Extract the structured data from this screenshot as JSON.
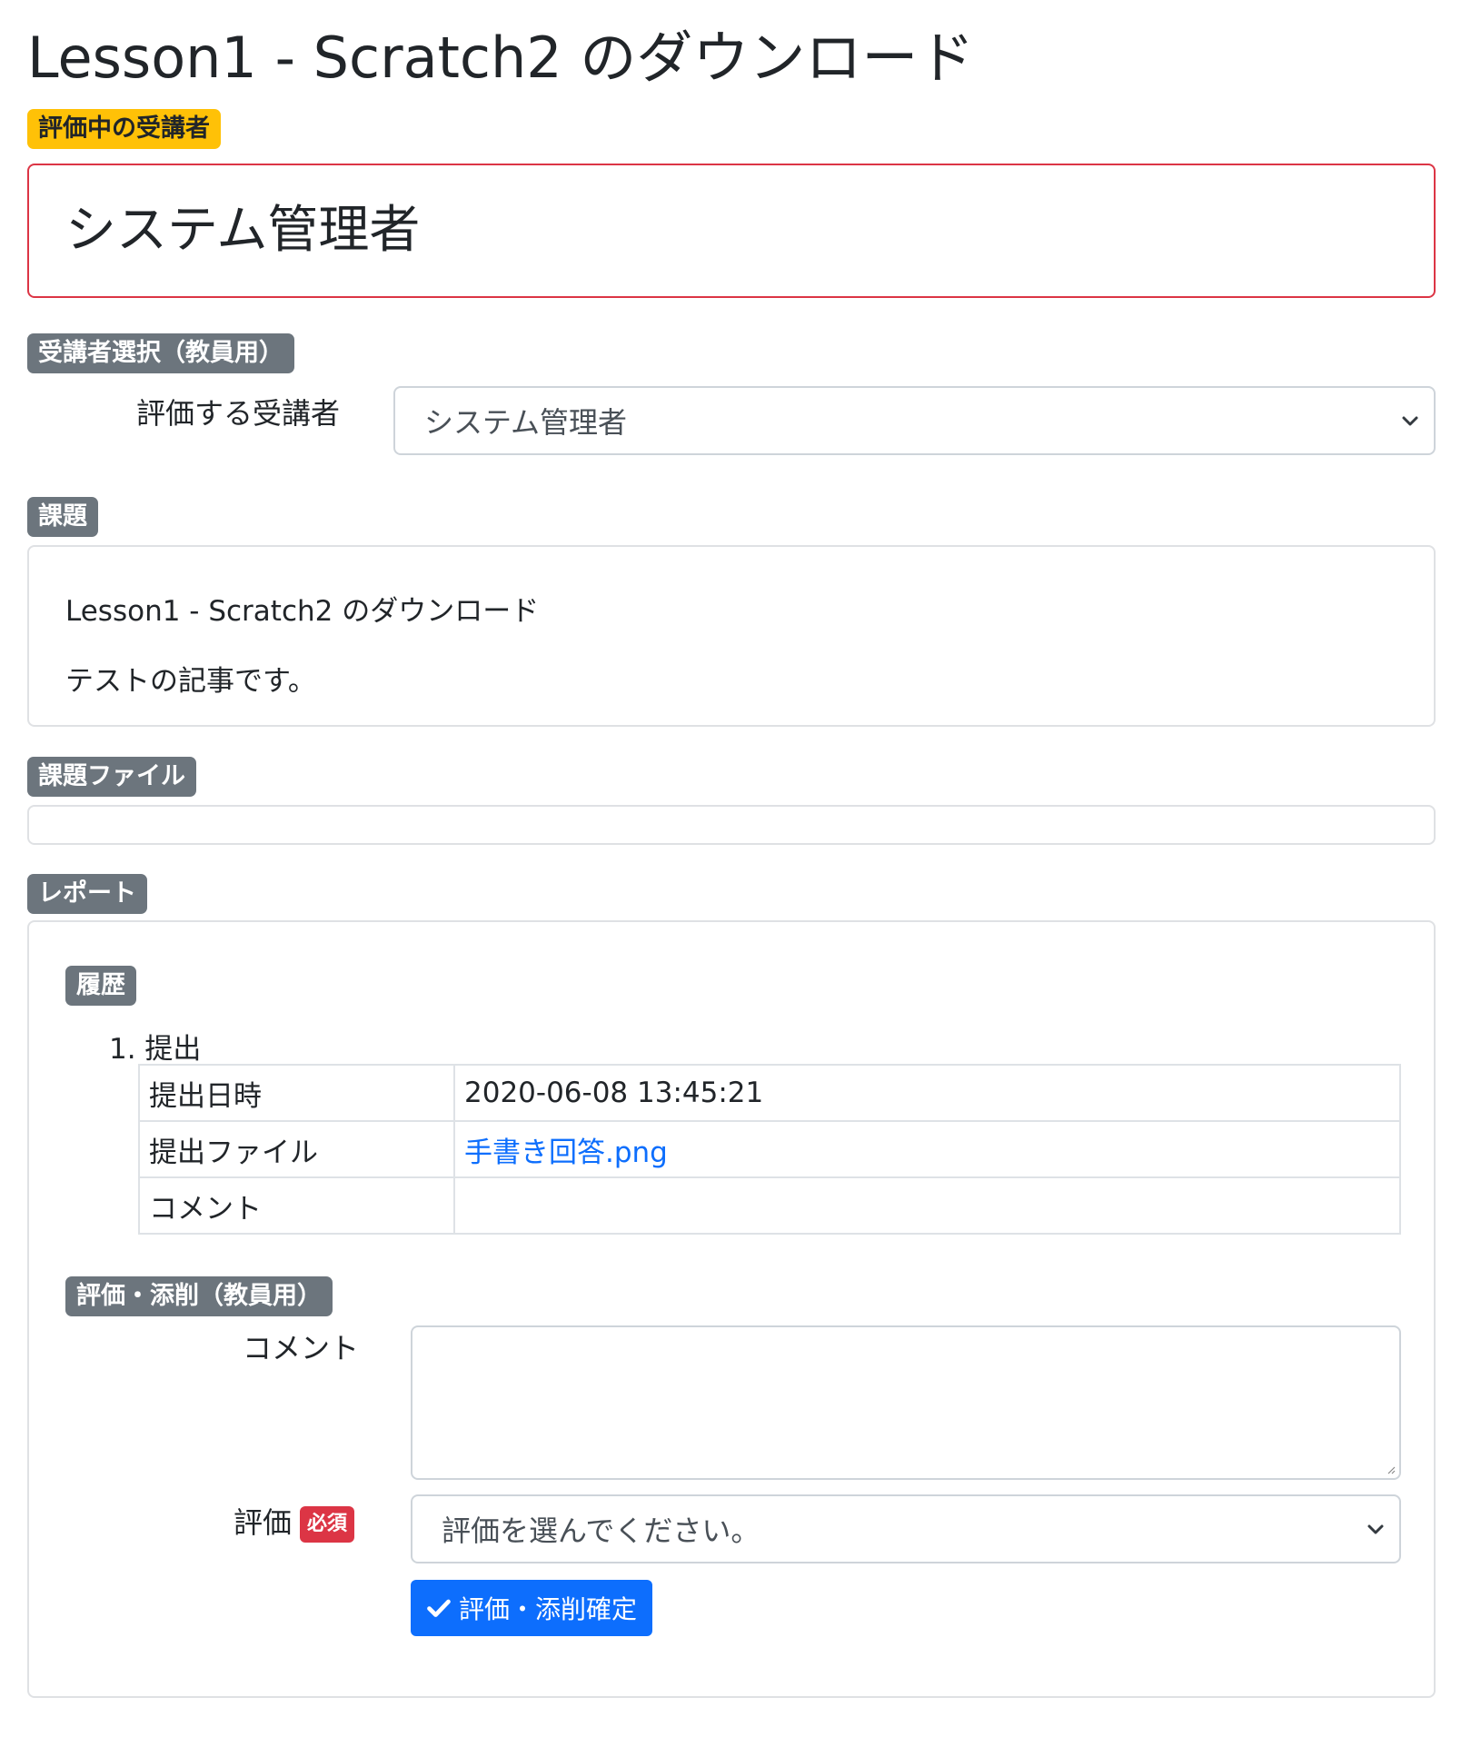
{
  "page": {
    "title": "Lesson1 - Scratch2 のダウンロード"
  },
  "current_student": {
    "badge": "評価中の受講者",
    "name": "システム管理者"
  },
  "student_select": {
    "badge": "受講者選択（教員用）",
    "label": "評価する受講者",
    "selected": "システム管理者"
  },
  "assignment": {
    "badge": "課題",
    "lines": [
      "Lesson1 - Scratch2 のダウンロード",
      "テストの記事です。"
    ]
  },
  "assignment_files": {
    "badge": "課題ファイル"
  },
  "report": {
    "badge": "レポート",
    "history": {
      "badge": "履歴",
      "items": [
        {
          "title": "1. 提出",
          "rows": [
            {
              "label": "提出日時",
              "value": "2020-06-08 13:45:21"
            },
            {
              "label": "提出ファイル",
              "value": "手書き回答.png"
            },
            {
              "label": "コメント",
              "value": ""
            }
          ]
        }
      ]
    },
    "evaluation": {
      "badge": "評価・添削（教員用）",
      "comment_label": "コメント",
      "comment_value": "",
      "grade_label": "評価",
      "required_badge": "必須",
      "grade_placeholder": "評価を選んでください。",
      "submit_label": "評価・添削確定"
    }
  },
  "colors": {
    "primary": "#0d6efd",
    "warning": "#ffc107",
    "secondary": "#6c757d",
    "danger": "#dc3545"
  },
  "icons": {
    "dropdown": "chevron-down-icon",
    "submit": "check-icon",
    "textarea_resize": "resize-handle-icon"
  }
}
